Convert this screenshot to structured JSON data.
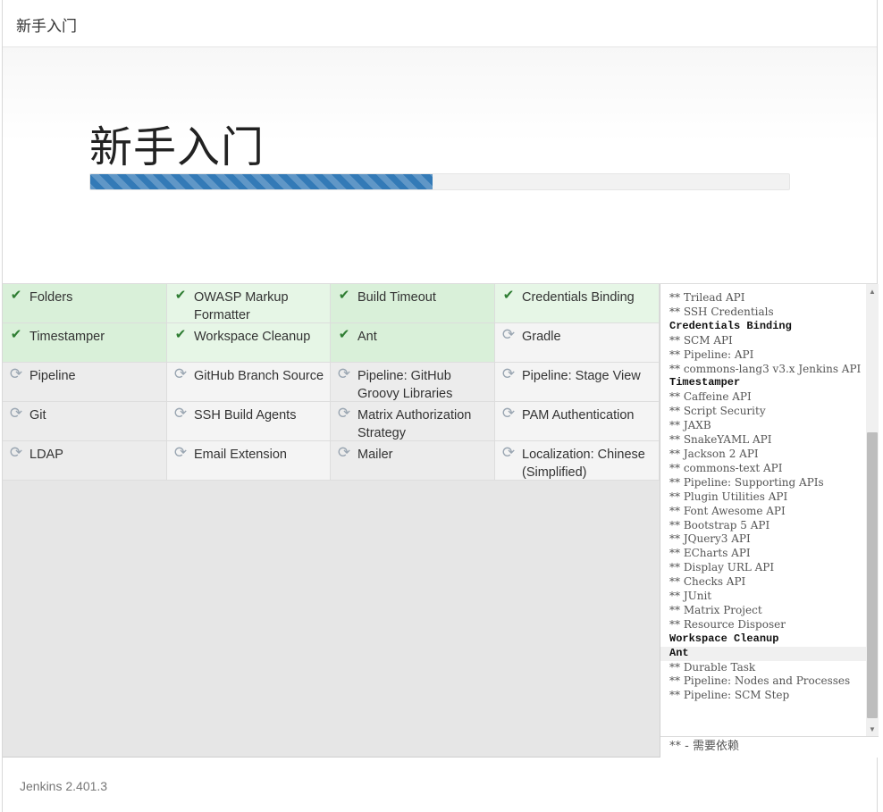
{
  "header": {
    "title": "新手入门"
  },
  "hero": {
    "title": "新手入门",
    "progress_percent": 49
  },
  "plugins": [
    {
      "label": "Folders",
      "status": "success"
    },
    {
      "label": "OWASP Markup Formatter",
      "status": "success"
    },
    {
      "label": "Build Timeout",
      "status": "success"
    },
    {
      "label": "Credentials Binding",
      "status": "success"
    },
    {
      "label": "Timestamper",
      "status": "success"
    },
    {
      "label": "Workspace Cleanup",
      "status": "success"
    },
    {
      "label": "Ant",
      "status": "success"
    },
    {
      "label": "Gradle",
      "status": "pending"
    },
    {
      "label": "Pipeline",
      "status": "pending"
    },
    {
      "label": "GitHub Branch Source",
      "status": "pending"
    },
    {
      "label": "Pipeline: GitHub Groovy Libraries",
      "status": "pending"
    },
    {
      "label": "Pipeline: Stage View",
      "status": "pending"
    },
    {
      "label": "Git",
      "status": "pending"
    },
    {
      "label": "SSH Build Agents",
      "status": "pending"
    },
    {
      "label": "Matrix Authorization Strategy",
      "status": "pending"
    },
    {
      "label": "PAM Authentication",
      "status": "pending"
    },
    {
      "label": "LDAP",
      "status": "pending"
    },
    {
      "label": "Email Extension",
      "status": "pending"
    },
    {
      "label": "Mailer",
      "status": "pending"
    },
    {
      "label": "Localization: Chinese (Simplified)",
      "status": "pending"
    }
  ],
  "icons": {
    "success": "check-icon",
    "pending": "refresh-icon"
  },
  "colors": {
    "success_bg": "#d9f0d9",
    "progress": "#337ab7",
    "check": "#2e7d32"
  },
  "log": {
    "lines": [
      {
        "text": "** Trilead API",
        "kind": "dep"
      },
      {
        "text": "** SSH Credentials",
        "kind": "dep"
      },
      {
        "text": "Credentials Binding",
        "kind": "plugin"
      },
      {
        "text": "** SCM API",
        "kind": "dep"
      },
      {
        "text": "** Pipeline: API",
        "kind": "dep"
      },
      {
        "text": "** commons-lang3 v3.x Jenkins API",
        "kind": "dep"
      },
      {
        "text": "Timestamper",
        "kind": "plugin"
      },
      {
        "text": "** Caffeine API",
        "kind": "dep"
      },
      {
        "text": "** Script Security",
        "kind": "dep"
      },
      {
        "text": "** JAXB",
        "kind": "dep"
      },
      {
        "text": "** SnakeYAML API",
        "kind": "dep"
      },
      {
        "text": "** Jackson 2 API",
        "kind": "dep"
      },
      {
        "text": "** commons-text API",
        "kind": "dep"
      },
      {
        "text": "** Pipeline: Supporting APIs",
        "kind": "dep"
      },
      {
        "text": "** Plugin Utilities API",
        "kind": "dep"
      },
      {
        "text": "** Font Awesome API",
        "kind": "dep"
      },
      {
        "text": "** Bootstrap 5 API",
        "kind": "dep"
      },
      {
        "text": "** JQuery3 API",
        "kind": "dep"
      },
      {
        "text": "** ECharts API",
        "kind": "dep"
      },
      {
        "text": "** Display URL API",
        "kind": "dep"
      },
      {
        "text": "** Checks API",
        "kind": "dep"
      },
      {
        "text": "** JUnit",
        "kind": "dep"
      },
      {
        "text": "** Matrix Project",
        "kind": "dep"
      },
      {
        "text": "** Resource Disposer",
        "kind": "dep"
      },
      {
        "text": "Workspace Cleanup",
        "kind": "plugin"
      },
      {
        "text": "Ant",
        "kind": "plugin",
        "highlight": true
      },
      {
        "text": "** Durable Task",
        "kind": "dep"
      },
      {
        "text": "** Pipeline: Nodes and Processes",
        "kind": "dep"
      },
      {
        "text": "** Pipeline: SCM Step",
        "kind": "dep"
      }
    ],
    "legend": "** - 需要依赖"
  },
  "footer": {
    "version": "Jenkins 2.401.3"
  }
}
